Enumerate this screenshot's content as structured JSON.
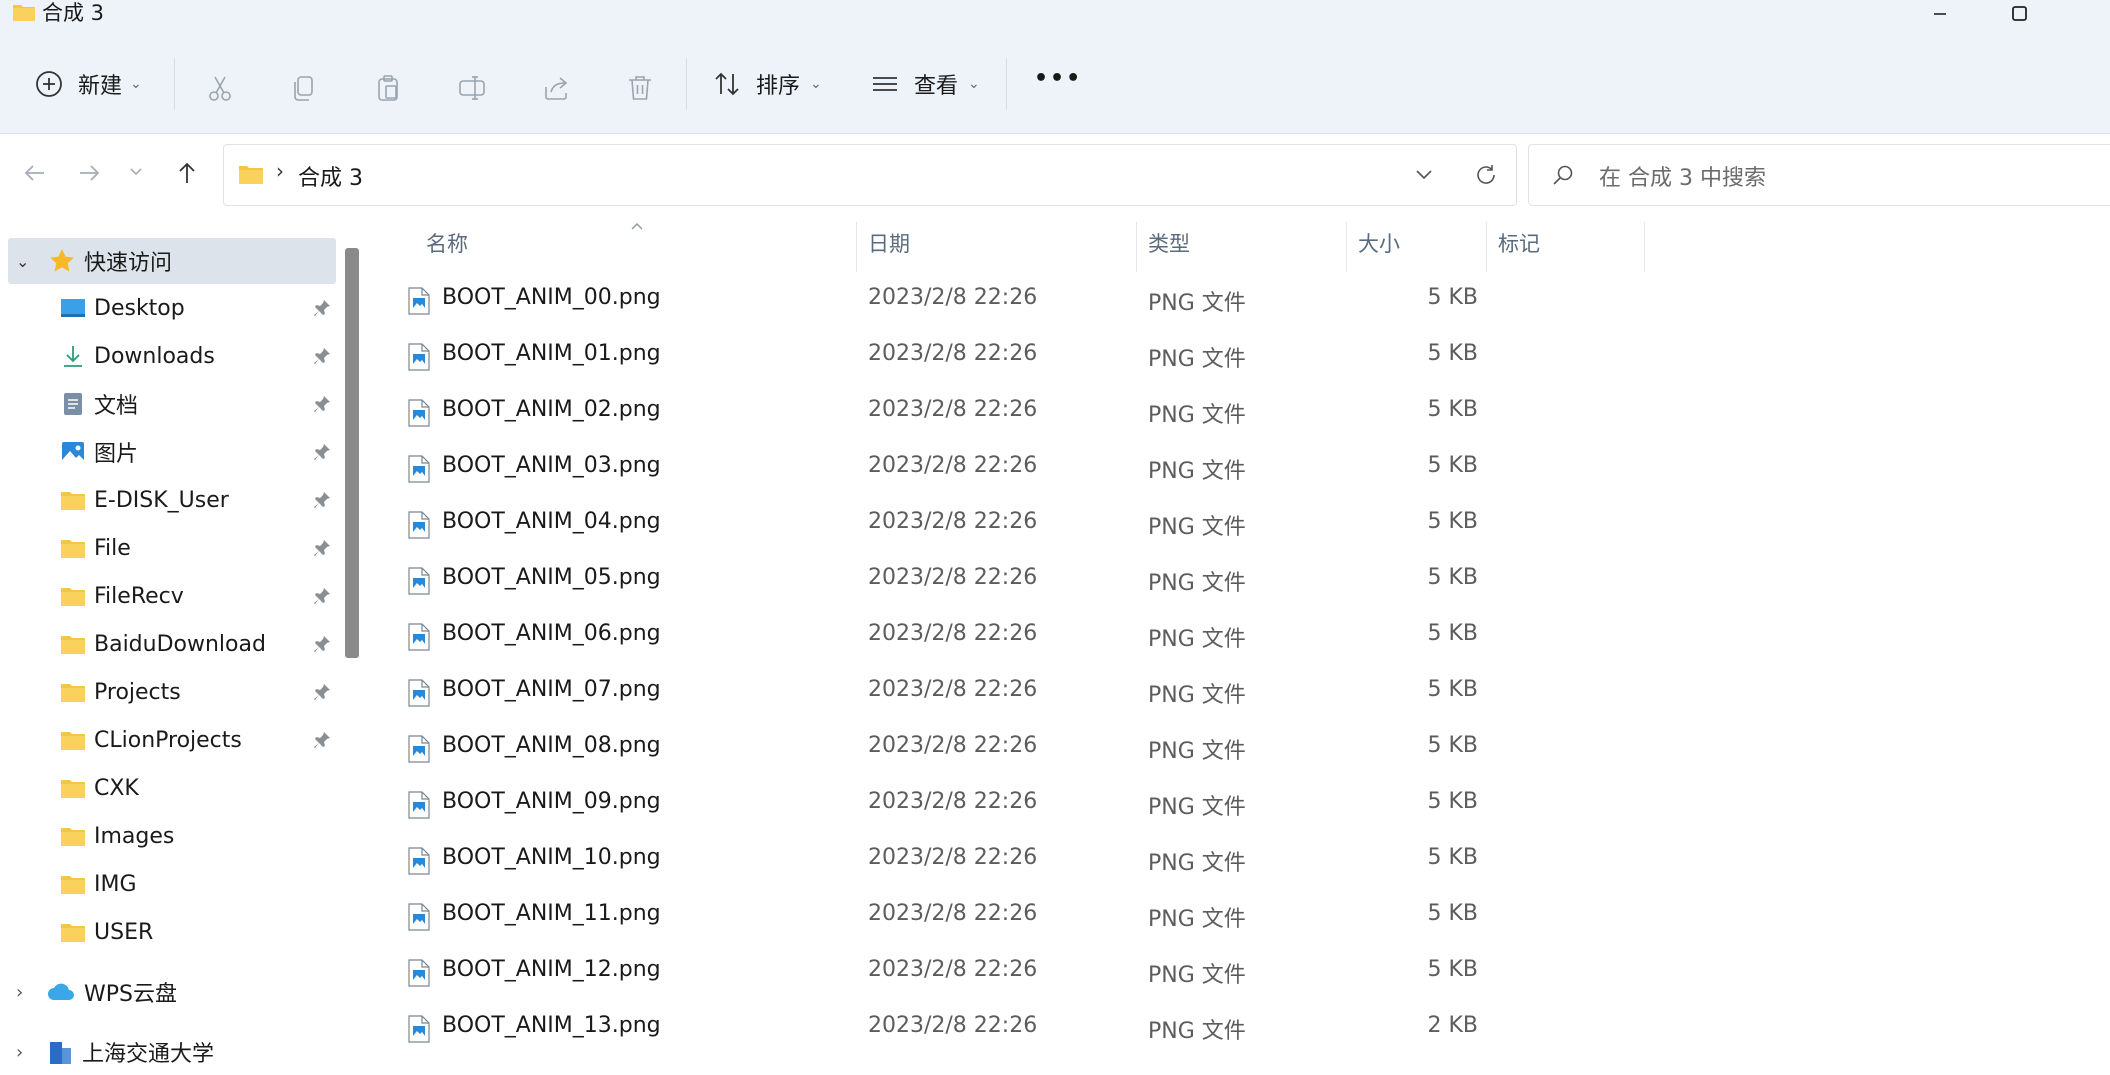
{
  "window": {
    "title": "合成 3"
  },
  "toolbar": {
    "new_label": "新建",
    "sort_label": "排序",
    "view_label": "查看",
    "more_label": "•••"
  },
  "nav": {
    "breadcrumb": "合成 3",
    "search_placeholder": "在 合成 3 中搜索"
  },
  "sidebar": {
    "quick_access": "快速访问",
    "items": [
      {
        "label": "Desktop",
        "icon": "desktop-icon",
        "pinned": true
      },
      {
        "label": "Downloads",
        "icon": "download-icon",
        "pinned": true
      },
      {
        "label": "文档",
        "icon": "document-icon",
        "pinned": true
      },
      {
        "label": "图片",
        "icon": "picture-icon",
        "pinned": true
      },
      {
        "label": "E-DISK_User",
        "icon": "folder-icon",
        "pinned": true
      },
      {
        "label": "File",
        "icon": "folder-icon",
        "pinned": true
      },
      {
        "label": "FileRecv",
        "icon": "folder-icon",
        "pinned": true
      },
      {
        "label": "BaiduDownload",
        "icon": "folder-icon",
        "pinned": true
      },
      {
        "label": "Projects",
        "icon": "folder-icon",
        "pinned": true
      },
      {
        "label": "CLionProjects",
        "icon": "folder-icon",
        "pinned": true
      },
      {
        "label": "CXK",
        "icon": "folder-icon",
        "pinned": false
      },
      {
        "label": "Images",
        "icon": "folder-icon",
        "pinned": false
      },
      {
        "label": "IMG",
        "icon": "folder-icon",
        "pinned": false
      },
      {
        "label": "USER",
        "icon": "folder-icon",
        "pinned": false
      }
    ],
    "wps": "WPS云盘",
    "sjtu": "上海交通大学"
  },
  "columns": {
    "name": "名称",
    "date": "日期",
    "type": "类型",
    "size": "大小",
    "tags": "标记"
  },
  "files": [
    {
      "name": "BOOT_ANIM_00.png",
      "date": "2023/2/8 22:26",
      "type": "PNG 文件",
      "size": "5 KB"
    },
    {
      "name": "BOOT_ANIM_01.png",
      "date": "2023/2/8 22:26",
      "type": "PNG 文件",
      "size": "5 KB"
    },
    {
      "name": "BOOT_ANIM_02.png",
      "date": "2023/2/8 22:26",
      "type": "PNG 文件",
      "size": "5 KB"
    },
    {
      "name": "BOOT_ANIM_03.png",
      "date": "2023/2/8 22:26",
      "type": "PNG 文件",
      "size": "5 KB"
    },
    {
      "name": "BOOT_ANIM_04.png",
      "date": "2023/2/8 22:26",
      "type": "PNG 文件",
      "size": "5 KB"
    },
    {
      "name": "BOOT_ANIM_05.png",
      "date": "2023/2/8 22:26",
      "type": "PNG 文件",
      "size": "5 KB"
    },
    {
      "name": "BOOT_ANIM_06.png",
      "date": "2023/2/8 22:26",
      "type": "PNG 文件",
      "size": "5 KB"
    },
    {
      "name": "BOOT_ANIM_07.png",
      "date": "2023/2/8 22:26",
      "type": "PNG 文件",
      "size": "5 KB"
    },
    {
      "name": "BOOT_ANIM_08.png",
      "date": "2023/2/8 22:26",
      "type": "PNG 文件",
      "size": "5 KB"
    },
    {
      "name": "BOOT_ANIM_09.png",
      "date": "2023/2/8 22:26",
      "type": "PNG 文件",
      "size": "5 KB"
    },
    {
      "name": "BOOT_ANIM_10.png",
      "date": "2023/2/8 22:26",
      "type": "PNG 文件",
      "size": "5 KB"
    },
    {
      "name": "BOOT_ANIM_11.png",
      "date": "2023/2/8 22:26",
      "type": "PNG 文件",
      "size": "5 KB"
    },
    {
      "name": "BOOT_ANIM_12.png",
      "date": "2023/2/8 22:26",
      "type": "PNG 文件",
      "size": "5 KB"
    },
    {
      "name": "BOOT_ANIM_13.png",
      "date": "2023/2/8 22:26",
      "type": "PNG 文件",
      "size": "2 KB"
    }
  ],
  "colors": {
    "accent": "#0067c0",
    "folder": "#f6c544",
    "chrome_bg": "#eef3f9",
    "selected_bg": "#dde3ea"
  }
}
